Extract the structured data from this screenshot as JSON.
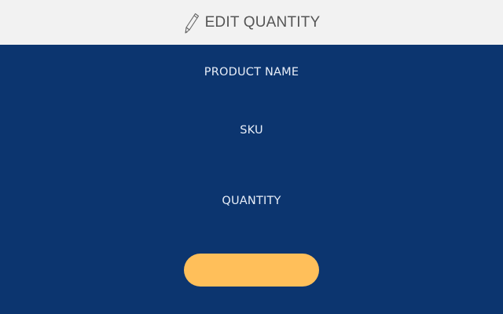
{
  "header": {
    "icon": "pencil-icon",
    "title": "EDIT QUANTITY"
  },
  "form": {
    "product_name_label": "PRODUCT NAME",
    "sku_label": "SKU",
    "quantity_label": "QUANTITY",
    "submit_label": ""
  },
  "colors": {
    "header_bg": "#f2f2f2",
    "main_bg": "#0c356f",
    "button_bg": "#ffbf5a",
    "label_text": "#e8eef8"
  }
}
